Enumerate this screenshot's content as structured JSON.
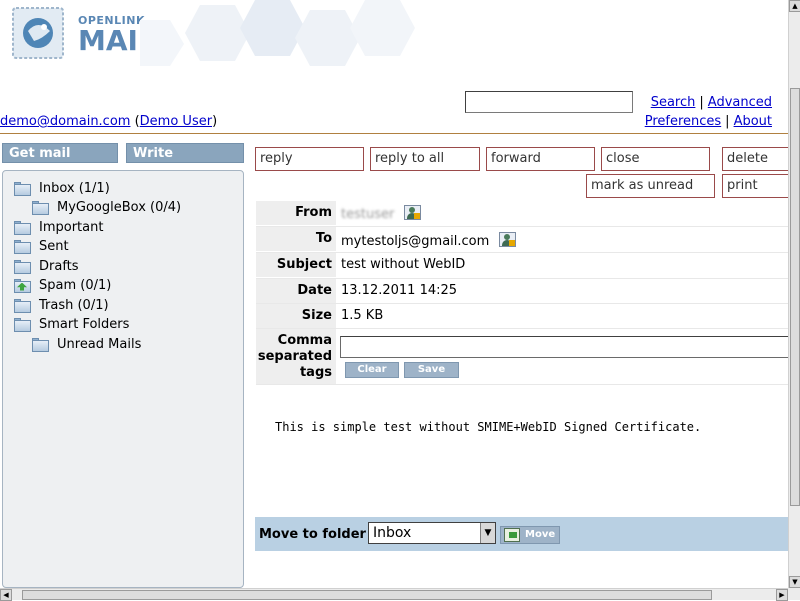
{
  "brand": {
    "line1": "OPENLINK",
    "line2": "MAIL"
  },
  "toplinks": {
    "search": "Search",
    "advanced": "Advanced",
    "preferences": "Preferences",
    "about": "About"
  },
  "user": {
    "email": "demo@domain.com",
    "name": "Demo User"
  },
  "left_buttons": {
    "get_mail": "Get mail",
    "write": "Write"
  },
  "folders": [
    {
      "label": "Inbox (1/1)"
    },
    {
      "label": "MyGoogleBox (0/4)"
    },
    {
      "label": "Important"
    },
    {
      "label": "Sent"
    },
    {
      "label": "Drafts"
    },
    {
      "label": "Spam (0/1)"
    },
    {
      "label": "Trash (0/1)"
    },
    {
      "label": "Smart Folders"
    },
    {
      "label": "Unread Mails"
    }
  ],
  "actions": {
    "reply": "reply",
    "reply_all": "reply to all",
    "forward": "forward",
    "close": "close",
    "delete": "delete",
    "mark_unread": "mark as unread",
    "print": "print"
  },
  "message": {
    "labels": {
      "from": "From",
      "to": "To",
      "subject": "Subject",
      "date": "Date",
      "size": "Size",
      "tags": "Comma separated tags"
    },
    "from": "testuser",
    "to": "mytestoljs@gmail.com",
    "subject": "test without WebID",
    "date": "13.12.2011 14:25",
    "size": "1.5 KB",
    "tags_value": "",
    "clear": "Clear",
    "save": "Save",
    "body": "This is simple test without SMIME+WebID Signed Certificate."
  },
  "move": {
    "label": "Move to folder",
    "selected": "Inbox",
    "button": "Move"
  }
}
